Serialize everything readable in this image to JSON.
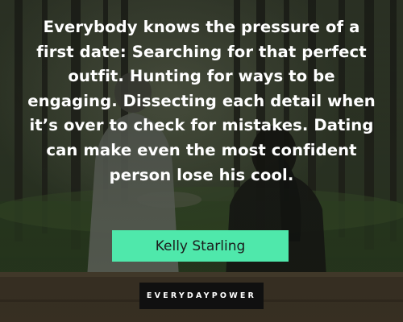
{
  "quote": {
    "lines": [
      "Everybody knows the pressure of a",
      "first date: Searching for that perfect",
      "outfit. Hunting for ways to be",
      "engaging. Dissecting each detail when",
      "it’s over to check for mistakes. Dating",
      "can make even the most confident",
      "person lose his cool."
    ]
  },
  "author": {
    "name": "Kelly Starling"
  },
  "brand": {
    "part1": "EVERYDAY",
    "part2": "POWER"
  },
  "colors": {
    "text": "#ffffff",
    "author_badge": "#4fe8ab",
    "author_text": "#1b1b1b",
    "brand_badge": "#101010",
    "brand_accent": "#ffffff"
  },
  "background": {
    "scene": "couple-sitting-on-bench-in-forest-photo",
    "icon": "photo-background-icon"
  }
}
